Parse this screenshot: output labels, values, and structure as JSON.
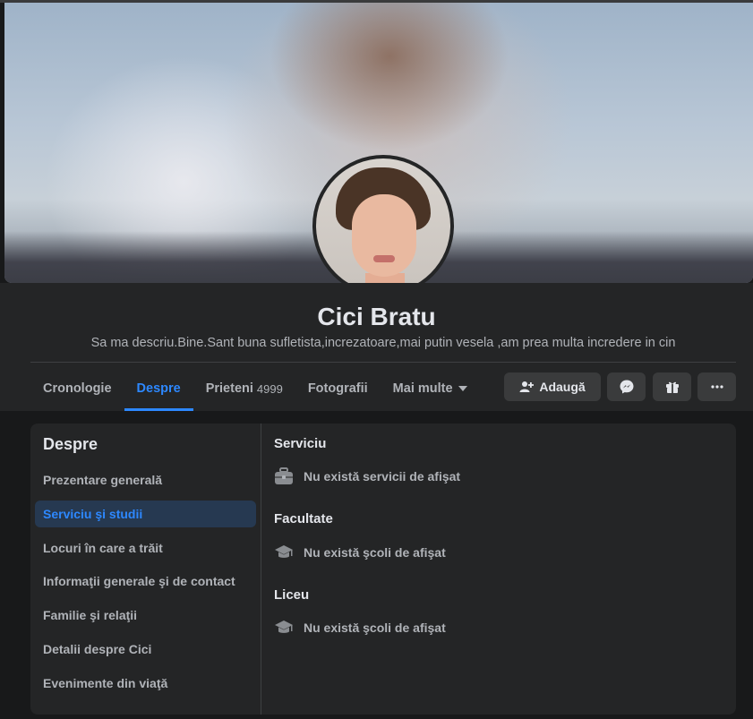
{
  "profile": {
    "name": "Cici Bratu",
    "bio": "Sa ma descriu.Bine.Sant buna sufletista,increzatoare,mai putin vesela ,am prea multa incredere in cin"
  },
  "tabs": [
    {
      "label": "Cronologie"
    },
    {
      "label": "Despre",
      "active": true
    },
    {
      "label": "Prieteni",
      "count": "4999"
    },
    {
      "label": "Fotografii"
    },
    {
      "label": "Mai multe"
    }
  ],
  "actions": {
    "add_label": "Adaugă",
    "icons": [
      "add-friend-icon",
      "messenger-icon",
      "gift-icon",
      "more-dots-icon"
    ]
  },
  "about": {
    "title": "Despre",
    "menu": [
      {
        "label": "Prezentare generală"
      },
      {
        "label": "Serviciu şi studii",
        "active": true
      },
      {
        "label": "Locuri în care a trăit"
      },
      {
        "label": "Informaţii generale şi de contact"
      },
      {
        "label": "Familie şi relaţii"
      },
      {
        "label": "Detalii despre Cici"
      },
      {
        "label": "Evenimente din viaţă"
      }
    ],
    "sections": [
      {
        "title": "Serviciu",
        "empty_text": "Nu există servicii de afişat",
        "icon": "briefcase-icon"
      },
      {
        "title": "Facultate",
        "empty_text": "Nu există şcoli de afişat",
        "icon": "graduation-cap-icon"
      },
      {
        "title": "Liceu",
        "empty_text": "Nu există şcoli de afişat",
        "icon": "graduation-cap-icon"
      }
    ]
  },
  "colors": {
    "accent": "#2d88ff",
    "panel": "#242526",
    "background": "#18191a"
  }
}
